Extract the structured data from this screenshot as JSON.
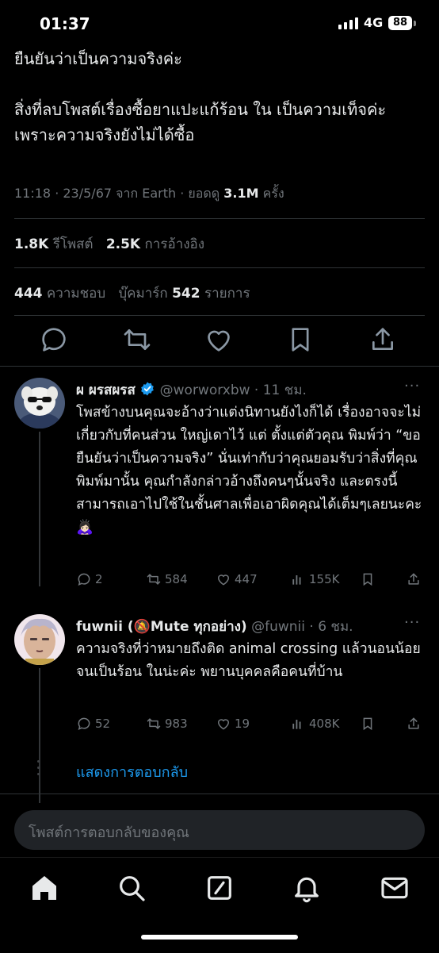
{
  "status_bar": {
    "time": "01:37",
    "network": "4G",
    "battery": "88"
  },
  "tweet": {
    "paragraph1": "ยืนยันว่าเป็นความจริงค่ะ",
    "paragraph2": "สิ่งที่ลบโพสต์เรื่องซื้อยาแปะแก้ร้อน ใน เป็นความเท็จค่ะ เพราะความจริงยังไม่ได้ซื้อ",
    "meta_prefix": "11:18 · 23/5/67 จาก Earth · ยอดดู ",
    "views": "3.1M",
    "meta_suffix": " ครั้ง",
    "reposts_count": "1.8K",
    "reposts_label": "รีโพสต์",
    "quotes_count": "2.5K",
    "quotes_label": "การอ้างอิง",
    "likes_count": "444",
    "likes_label": "ความชอบ",
    "bookmarks_label": "บุ๊คมาร์ก",
    "bookmarks_count": "542",
    "bookmarks_suffix": "รายการ"
  },
  "replies": [
    {
      "name": "ผ ผรสผรส",
      "handle": "@worworxbw · 11 ชม.",
      "text": "โพสข้างบนคุณจะอ้างว่าแต่งนิทานยังไงก็ได้ เรื่องอาจจะไม่เกี่ยวกับที่คนส่วน ใหญ่เดาไว้ แต่ ตั้งแต่ตัวคุณ พิมพ์ว่า “ขอยืนยันว่าเป็นความจริง” นั่นเท่ากับว่าคุณยอมรับว่าสิ่งที่คุณพิมพ์มานั้น คุณกำลังกล่าวอ้างถึงคนๆนั้นจริง และตรงนี้สามารถเอาไปใช้ในชั้นศาลเพื่อเอาผิดคุณได้เต็มๆเลยนะคะ 🙇🏻‍♀️",
      "replies": "2",
      "reposts": "584",
      "likes": "447",
      "views": "155K"
    },
    {
      "name": "fuwnii (🔕Mute ทุกอย่าง)",
      "handle": "@fuwnii · 6 ชม.",
      "text": "ความจริงที่ว่าหมายถึงติด animal crossing แล้วนอนน้อยจนเป็นร้อน ในน่ะค่ะ พยานบุคคลคือคนที่บ้าน",
      "replies": "52",
      "reposts": "983",
      "likes": "19",
      "views": "408K"
    }
  ],
  "show_replies": "แสดงการตอบกลับ",
  "composer_placeholder": "โพสต์การตอบกลับของคุณ",
  "tabs": [
    "home-icon",
    "search-icon",
    "grok-icon",
    "notifications-icon",
    "messages-icon"
  ]
}
